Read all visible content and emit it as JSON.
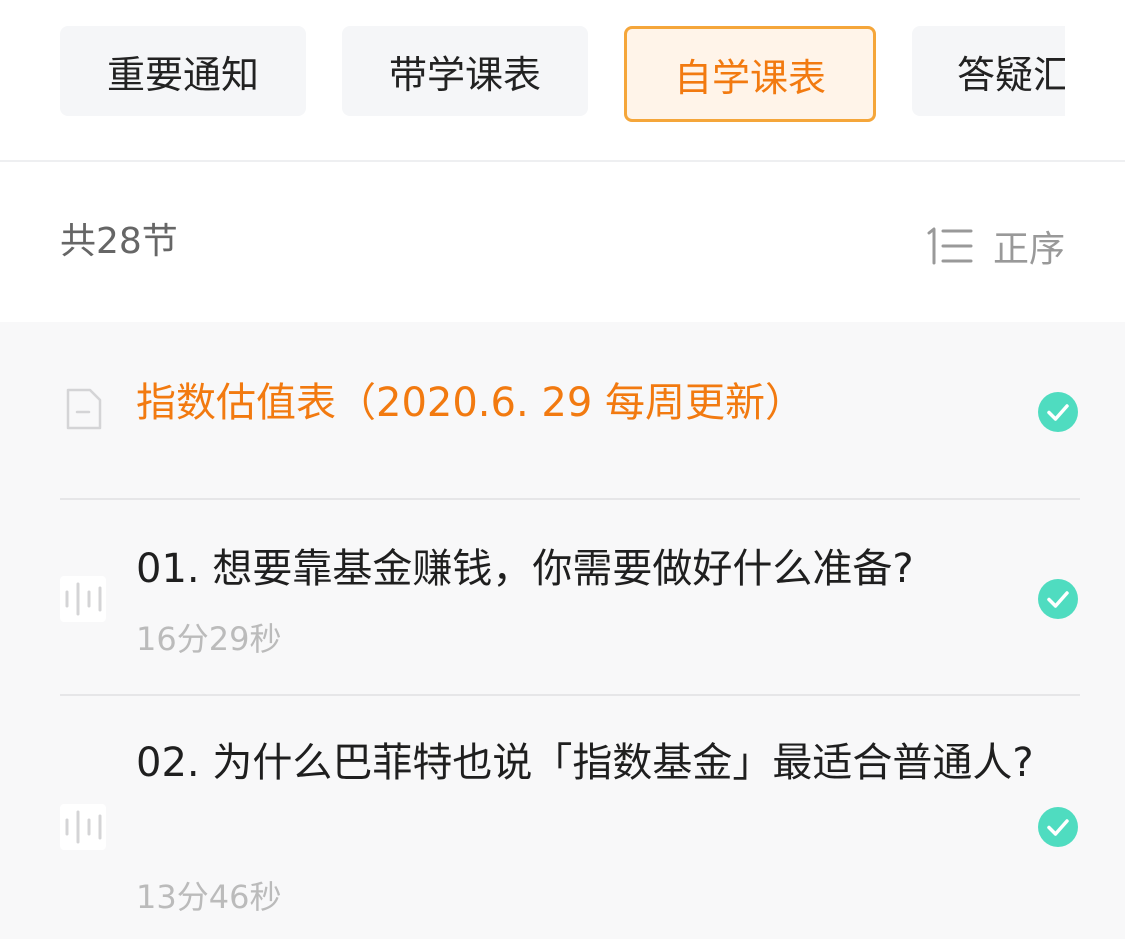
{
  "tabs": [
    {
      "label": "重要通知"
    },
    {
      "label": "带学课表"
    },
    {
      "label": "自学课表"
    },
    {
      "label": "答疑汇"
    }
  ],
  "active_tab": "自学课表",
  "summary": {
    "count_label": "共28节",
    "sort_label": "正序",
    "sort_icon": "sort-order-icon"
  },
  "lessons": [
    {
      "title": "指数估值表（2020.6. 29 每周更新）",
      "type_icon": "document-icon",
      "completed": true
    },
    {
      "title": "01. 想要靠基金赚钱，你需要做好什么准备?",
      "duration": "16分29秒",
      "type_icon": "audio-icon",
      "completed": true
    },
    {
      "title": "02. 为什么巴菲特也说「指数基金」最适合普通人?",
      "duration": "13分46秒",
      "type_icon": "audio-icon",
      "completed": true
    }
  ],
  "colors": {
    "accent": "#f27a10",
    "accent_border": "#f5a63a",
    "check": "#4fdcc0",
    "muted": "#bbbbbb"
  }
}
